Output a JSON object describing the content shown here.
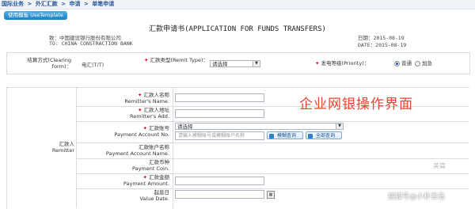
{
  "breadcrumb": {
    "items": [
      "国际业务",
      "外汇汇款",
      "申请",
      "单笔申请"
    ],
    "separator": ">"
  },
  "template_button": {
    "label": "使用模板 UseTemplate"
  },
  "form": {
    "title": "汇款申请书(APPLICATION FOR FUNDS TRANSFERS)",
    "to_cn": "致：中国建设银行股份有限公司",
    "to_en": "TO: CHINA CONSTRACTION BANK",
    "date_cn": "日期：2015-08-19",
    "date_en": "DATE：2015-08-19"
  },
  "settlement": {
    "label": "结算方式(Clearing form)：",
    "value": "电汇(T/T)",
    "remit_type_label": "汇款类型(Remit Type)：",
    "remit_type_value": "请选择",
    "priority_label": "发电等级(Priority)：",
    "priority_options": [
      "普通",
      "加急"
    ],
    "priority_selected": "普通"
  },
  "remitter": {
    "section_label_cn": "汇款人",
    "section_label_en": "Remitter",
    "name_cn": "汇款人名称",
    "name_en": "Remitter's Name.",
    "addr_cn": "汇款人地址",
    "addr_en": "Remitter's Add.",
    "acct_cn": "汇款账号",
    "acct_en": "Payment Account No.",
    "acct_select": "请选择",
    "acct_placeholder": "请输入模糊账号或模糊账户名称",
    "fuzzy_query_label": "模糊查询",
    "all_query_label": "全部查询",
    "acct_name_cn": "汇款账户名称",
    "acct_name_en": "Payment Account Name.",
    "currency_cn": "汇款币种",
    "currency_en": "Payment Coin.",
    "amount_cn": "汇款金额",
    "amount_en": "Payment Amount.",
    "value_date_cn": "起息日",
    "value_date_en": "Value Date."
  },
  "overlay_text": "企业网银操作界面",
  "watermarks": {
    "meipian": "美篇",
    "sohu": "搜狐号@小朴青岛"
  },
  "colors": {
    "accent": "#1d7fc4",
    "overlay": "#e8432e",
    "required": "#d0021b"
  }
}
